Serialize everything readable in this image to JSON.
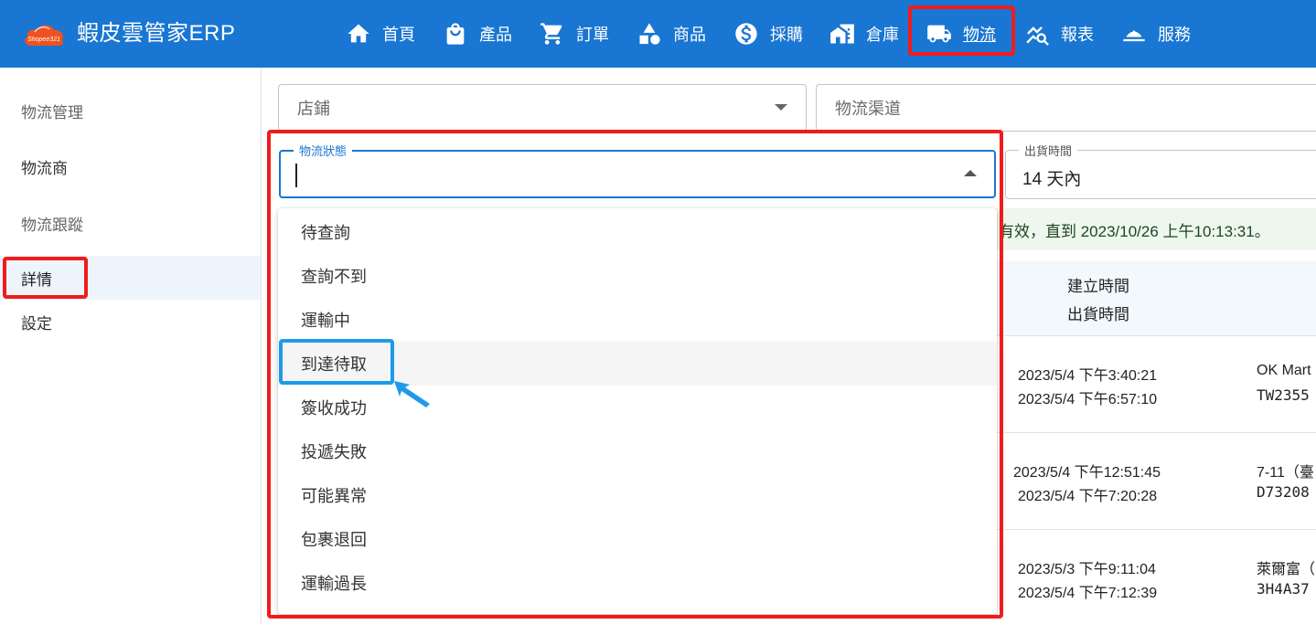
{
  "app": {
    "brand": "蝦皮雲管家ERP",
    "logo_text": "Shopee321"
  },
  "nav": [
    {
      "label": "首頁",
      "icon": "home-icon"
    },
    {
      "label": "產品",
      "icon": "shopping-bag-icon"
    },
    {
      "label": "訂單",
      "icon": "cart-icon"
    },
    {
      "label": "商品",
      "icon": "shapes-icon"
    },
    {
      "label": "採購",
      "icon": "dollar-icon"
    },
    {
      "label": "倉庫",
      "icon": "warehouse-icon"
    },
    {
      "label": "物流",
      "icon": "truck-icon",
      "active": true
    },
    {
      "label": "報表",
      "icon": "chart-search-icon"
    },
    {
      "label": "服務",
      "icon": "service-bell-icon"
    }
  ],
  "sidebar": {
    "items": [
      {
        "label": "物流管理",
        "type": "header"
      },
      {
        "label": "物流商",
        "type": "item"
      },
      {
        "label": "物流跟蹤",
        "type": "header"
      },
      {
        "label": "詳情",
        "type": "item",
        "selected": true
      },
      {
        "label": "設定",
        "type": "item"
      }
    ]
  },
  "filters": {
    "store_placeholder": "店鋪",
    "channel_placeholder": "物流渠道",
    "status_label": "物流狀態",
    "status_value": "",
    "ship_time_label": "出貨時間",
    "ship_time_value": "14 天內"
  },
  "alert": {
    "text": "有效，直到 2023/10/26 上午10:13:31。"
  },
  "status_options": [
    "待查詢",
    "查詢不到",
    "運輸中",
    "到達待取",
    "簽收成功",
    "投遞失敗",
    "可能異常",
    "包裹退回",
    "運輸過長"
  ],
  "table": {
    "headers": {
      "created": "建立時間",
      "shipped": "出貨時間"
    },
    "rows": [
      {
        "created": "2023/5/4 下午3:40:21",
        "shipped": "2023/5/4 下午6:57:10",
        "store": "OK Mart",
        "tracking": "TW2355"
      },
      {
        "created": "2023/5/4 下午12:51:45",
        "shipped": "2023/5/4 下午7:20:28",
        "store": "7-11（臺",
        "tracking": "D73208"
      },
      {
        "created": "2023/5/3 下午9:11:04",
        "shipped": "2023/5/4 下午7:12:39",
        "store": "萊爾富（",
        "tracking": "3H4A37"
      }
    ]
  },
  "colors": {
    "primary": "#1976d2",
    "highlight_red": "#f21b1b",
    "highlight_blue": "#1e9be8",
    "alert_bg": "#edf7ed"
  }
}
